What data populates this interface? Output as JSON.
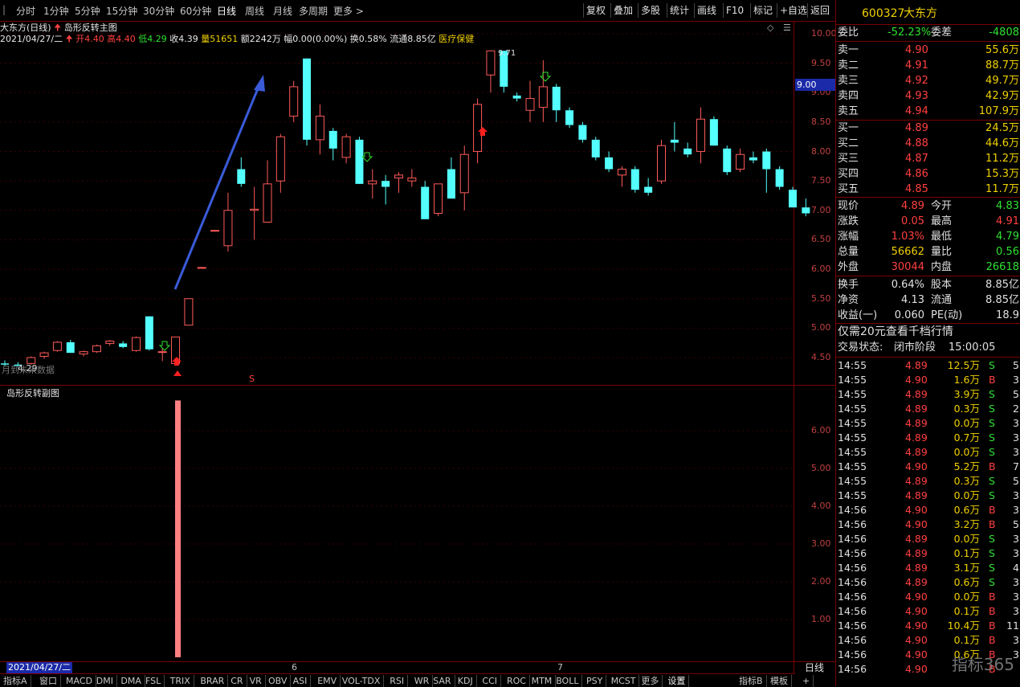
{
  "toolbar": {
    "periods": [
      "分时",
      "1分钟",
      "5分钟",
      "15分钟",
      "30分钟",
      "60分钟",
      "日线",
      "周线",
      "月线",
      "多周期",
      "更多 >"
    ],
    "active_period": "日线",
    "buttons": [
      "复权",
      "叠加",
      "多股",
      "统计",
      "画线",
      "F10",
      "标记",
      "+自选",
      "返回"
    ]
  },
  "chart": {
    "title": "大东方(日线)",
    "indicator_main": "岛形反转主图",
    "date": "2021/04/27/二",
    "open_label": "开",
    "open": "4.40",
    "high_label": "高",
    "high": "4.40",
    "low_label": "低",
    "low": "4.29",
    "close_label": "收",
    "close": "4.39",
    "vol_label": "量",
    "vol": "51651",
    "amount": "额2242万",
    "change": "幅0.00(0.00%)",
    "turnover": "换0.58%",
    "float": "流通8.85亿",
    "sector": "医疗保健",
    "peak_label": "9.71",
    "low_marker": "4.29",
    "no_data_text": "月到未来数据",
    "price_flag": "9.00",
    "s_marker": "S",
    "y_axis": [
      "10.00",
      "9.50",
      "9.00",
      "8.50",
      "8.00",
      "7.50",
      "7.00",
      "6.50",
      "6.00",
      "5.50",
      "5.00",
      "4.50"
    ],
    "indicator_sub": "岛形反转副图",
    "sub_axis": [
      "6.00",
      "5.00",
      "4.00",
      "3.00",
      "2.00",
      "1.00"
    ],
    "signal_value": 6.8,
    "x_dates": [
      "2021/04/27/二",
      "6",
      "7"
    ],
    "period_button": "日线",
    "candles": [
      {
        "o": 4.4,
        "h": 4.45,
        "l": 4.36,
        "c": 4.38
      },
      {
        "o": 4.38,
        "h": 4.42,
        "l": 4.33,
        "c": 4.36
      },
      {
        "o": 4.4,
        "h": 4.52,
        "l": 4.38,
        "c": 4.5
      },
      {
        "o": 4.52,
        "h": 4.6,
        "l": 4.48,
        "c": 4.58
      },
      {
        "o": 4.62,
        "h": 4.78,
        "l": 4.6,
        "c": 4.76
      },
      {
        "o": 4.76,
        "h": 4.8,
        "l": 4.58,
        "c": 4.58
      },
      {
        "o": 4.56,
        "h": 4.62,
        "l": 4.52,
        "c": 4.6
      },
      {
        "o": 4.6,
        "h": 4.72,
        "l": 4.58,
        "c": 4.7
      },
      {
        "o": 4.74,
        "h": 4.8,
        "l": 4.7,
        "c": 4.78
      },
      {
        "o": 4.74,
        "h": 4.78,
        "l": 4.66,
        "c": 4.68
      },
      {
        "o": 4.62,
        "h": 4.86,
        "l": 4.6,
        "c": 4.84
      },
      {
        "o": 5.2,
        "h": 5.2,
        "l": 4.62,
        "c": 4.64
      },
      {
        "o": 4.6,
        "h": 4.66,
        "l": 4.44,
        "c": 4.6
      },
      {
        "o": 4.4,
        "h": 4.85,
        "l": 4.4,
        "c": 4.85
      },
      {
        "o": 5.05,
        "h": 5.5,
        "l": 5.05,
        "c": 5.5
      },
      {
        "o": 6.02,
        "h": 6.04,
        "l": 6.02,
        "c": 6.03
      },
      {
        "o": 6.65,
        "h": 6.67,
        "l": 6.64,
        "c": 6.66
      },
      {
        "o": 6.4,
        "h": 7.3,
        "l": 6.3,
        "c": 7.0
      },
      {
        "o": 7.7,
        "h": 7.9,
        "l": 7.4,
        "c": 7.45
      },
      {
        "o": 7.0,
        "h": 7.4,
        "l": 6.5,
        "c": 7.02
      },
      {
        "o": 6.8,
        "h": 7.85,
        "l": 6.8,
        "c": 7.45
      },
      {
        "o": 7.5,
        "h": 8.3,
        "l": 7.3,
        "c": 8.25
      },
      {
        "o": 8.6,
        "h": 9.2,
        "l": 8.5,
        "c": 9.1
      },
      {
        "o": 9.58,
        "h": 9.58,
        "l": 8.1,
        "c": 8.2
      },
      {
        "o": 8.2,
        "h": 8.8,
        "l": 7.95,
        "c": 8.6
      },
      {
        "o": 8.35,
        "h": 8.4,
        "l": 7.85,
        "c": 8.05
      },
      {
        "o": 7.9,
        "h": 8.3,
        "l": 7.8,
        "c": 8.25
      },
      {
        "o": 8.2,
        "h": 8.25,
        "l": 7.45,
        "c": 7.45
      },
      {
        "o": 7.45,
        "h": 7.7,
        "l": 7.2,
        "c": 7.5
      },
      {
        "o": 7.5,
        "h": 7.6,
        "l": 7.1,
        "c": 7.4
      },
      {
        "o": 7.55,
        "h": 7.65,
        "l": 7.3,
        "c": 7.6
      },
      {
        "o": 7.5,
        "h": 7.7,
        "l": 7.4,
        "c": 7.55
      },
      {
        "o": 7.4,
        "h": 7.5,
        "l": 6.85,
        "c": 6.85
      },
      {
        "o": 6.95,
        "h": 7.45,
        "l": 6.9,
        "c": 7.45
      },
      {
        "o": 7.7,
        "h": 7.9,
        "l": 7.3,
        "c": 7.2
      },
      {
        "o": 7.3,
        "h": 8.1,
        "l": 7.0,
        "c": 7.95
      },
      {
        "o": 8.0,
        "h": 8.9,
        "l": 7.8,
        "c": 8.8
      },
      {
        "o": 9.3,
        "h": 9.72,
        "l": 9.0,
        "c": 9.71
      },
      {
        "o": 9.71,
        "h": 9.71,
        "l": 9.0,
        "c": 9.1
      },
      {
        "o": 8.95,
        "h": 9.0,
        "l": 8.85,
        "c": 8.9
      },
      {
        "o": 8.7,
        "h": 9.2,
        "l": 8.5,
        "c": 8.9
      },
      {
        "o": 8.75,
        "h": 9.55,
        "l": 8.5,
        "c": 9.1
      },
      {
        "o": 9.1,
        "h": 9.15,
        "l": 8.5,
        "c": 8.7
      },
      {
        "o": 8.7,
        "h": 8.75,
        "l": 8.4,
        "c": 8.45
      },
      {
        "o": 8.45,
        "h": 8.5,
        "l": 8.15,
        "c": 8.2
      },
      {
        "o": 8.2,
        "h": 8.25,
        "l": 7.85,
        "c": 7.9
      },
      {
        "o": 7.9,
        "h": 8.0,
        "l": 7.65,
        "c": 7.7
      },
      {
        "o": 7.6,
        "h": 7.75,
        "l": 7.4,
        "c": 7.7
      },
      {
        "o": 7.7,
        "h": 7.75,
        "l": 7.3,
        "c": 7.35
      },
      {
        "o": 7.4,
        "h": 7.55,
        "l": 7.25,
        "c": 7.3
      },
      {
        "o": 7.5,
        "h": 8.2,
        "l": 7.45,
        "c": 8.1
      },
      {
        "o": 8.2,
        "h": 8.5,
        "l": 8.0,
        "c": 8.15
      },
      {
        "o": 8.05,
        "h": 8.15,
        "l": 7.9,
        "c": 7.95
      },
      {
        "o": 8.0,
        "h": 8.75,
        "l": 7.8,
        "c": 8.55
      },
      {
        "o": 8.55,
        "h": 8.6,
        "l": 8.1,
        "c": 8.1
      },
      {
        "o": 8.05,
        "h": 8.1,
        "l": 7.6,
        "c": 7.65
      },
      {
        "o": 7.7,
        "h": 8.05,
        "l": 7.65,
        "c": 7.95
      },
      {
        "o": 7.9,
        "h": 8.0,
        "l": 7.8,
        "c": 7.85
      },
      {
        "o": 8.0,
        "h": 8.05,
        "l": 7.3,
        "c": 7.7
      },
      {
        "o": 7.7,
        "h": 7.75,
        "l": 7.35,
        "c": 7.4
      },
      {
        "o": 7.35,
        "h": 7.4,
        "l": 7.05,
        "c": 7.05
      },
      {
        "o": 7.05,
        "h": 7.2,
        "l": 6.9,
        "c": 6.95
      }
    ]
  },
  "tabs": [
    "指标A",
    "窗口",
    "MACD",
    "DMI",
    "DMA",
    "FSL",
    "TRIX",
    "BRAR",
    "CR",
    "VR",
    "OBV",
    "ASI",
    "EMV",
    "VOL-TDX",
    "RSI",
    "WR",
    "SAR",
    "KDJ",
    "CCI",
    "ROC",
    "MTM",
    "BOLL",
    "PSY",
    "MCST",
    "更多",
    "设置"
  ],
  "tabs_right": [
    "指标B",
    "模板",
    "+"
  ],
  "panel": {
    "code": "600327",
    "name": "大东方",
    "wei_label": "委比",
    "wei_value": "-52.23%",
    "weicha_label": "委差",
    "weicha_value": "-4808",
    "sells": [
      {
        "label": "卖五",
        "price": "4.94",
        "vol": "107.9万"
      },
      {
        "label": "卖四",
        "price": "4.93",
        "vol": "42.9万"
      },
      {
        "label": "卖三",
        "price": "4.92",
        "vol": "49.7万"
      },
      {
        "label": "卖二",
        "price": "4.91",
        "vol": "88.7万"
      },
      {
        "label": "卖一",
        "price": "4.90",
        "vol": "55.6万"
      }
    ],
    "buys": [
      {
        "label": "买一",
        "price": "4.89",
        "vol": "24.5万"
      },
      {
        "label": "买二",
        "price": "4.88",
        "vol": "44.6万"
      },
      {
        "label": "买三",
        "price": "4.87",
        "vol": "11.2万"
      },
      {
        "label": "买四",
        "price": "4.86",
        "vol": "15.3万"
      },
      {
        "label": "买五",
        "price": "4.85",
        "vol": "11.7万"
      }
    ],
    "quote": [
      {
        "l1": "现价",
        "v1": "4.89",
        "l2": "今开",
        "v2": "4.83"
      },
      {
        "l1": "涨跌",
        "v1": "0.05",
        "l2": "最高",
        "v2": "4.91"
      },
      {
        "l1": "涨幅",
        "v1": "1.03%",
        "l2": "最低",
        "v2": "4.79"
      },
      {
        "l1": "总量",
        "v1": "56662",
        "l2": "量比",
        "v2": "0.56"
      },
      {
        "l1": "外盘",
        "v1": "30044",
        "l2": "内盘",
        "v2": "26618"
      }
    ],
    "fund": [
      {
        "l1": "换手",
        "v1": "0.64%",
        "l2": "股本",
        "v2": "8.85亿"
      },
      {
        "l1": "净资",
        "v1": "4.13",
        "l2": "流通",
        "v2": "8.85亿"
      },
      {
        "l1": "收益(一)",
        "v1": "0.060",
        "l2": "PE(动)",
        "v2": "18.9"
      }
    ],
    "promo": "仅需20元查看千档行情",
    "status_label": "交易状态:",
    "status": "闭市阶段",
    "status_time": "15:00:05",
    "trades": [
      {
        "t": "14:55",
        "p": "4.89",
        "v": "12.5万",
        "s": "S",
        "n": "5"
      },
      {
        "t": "14:55",
        "p": "4.90",
        "v": "1.6万",
        "s": "B",
        "n": "3"
      },
      {
        "t": "14:55",
        "p": "4.89",
        "v": "3.9万",
        "s": "S",
        "n": "5"
      },
      {
        "t": "14:55",
        "p": "4.89",
        "v": "0.3万",
        "s": "S",
        "n": "2"
      },
      {
        "t": "14:55",
        "p": "4.89",
        "v": "0.0万",
        "s": "S",
        "n": "3"
      },
      {
        "t": "14:55",
        "p": "4.89",
        "v": "0.7万",
        "s": "S",
        "n": "3"
      },
      {
        "t": "14:55",
        "p": "4.89",
        "v": "0.0万",
        "s": "S",
        "n": "3"
      },
      {
        "t": "14:55",
        "p": "4.90",
        "v": "5.2万",
        "s": "B",
        "n": "7"
      },
      {
        "t": "14:55",
        "p": "4.89",
        "v": "0.3万",
        "s": "S",
        "n": "5"
      },
      {
        "t": "14:55",
        "p": "4.89",
        "v": "0.0万",
        "s": "S",
        "n": "3"
      },
      {
        "t": "14:56",
        "p": "4.90",
        "v": "0.6万",
        "s": "B",
        "n": "3"
      },
      {
        "t": "14:56",
        "p": "4.90",
        "v": "3.2万",
        "s": "B",
        "n": "5"
      },
      {
        "t": "14:56",
        "p": "4.89",
        "v": "0.0万",
        "s": "S",
        "n": "3"
      },
      {
        "t": "14:56",
        "p": "4.89",
        "v": "0.1万",
        "s": "S",
        "n": "3"
      },
      {
        "t": "14:56",
        "p": "4.89",
        "v": "3.1万",
        "s": "S",
        "n": "4"
      },
      {
        "t": "14:56",
        "p": "4.89",
        "v": "0.6万",
        "s": "S",
        "n": "3"
      },
      {
        "t": "14:56",
        "p": "4.90",
        "v": "0.0万",
        "s": "B",
        "n": "3"
      },
      {
        "t": "14:56",
        "p": "4.90",
        "v": "0.1万",
        "s": "B",
        "n": "3"
      },
      {
        "t": "14:56",
        "p": "4.90",
        "v": "10.4万",
        "s": "B",
        "n": "11"
      },
      {
        "t": "14:56",
        "p": "4.90",
        "v": "0.1万",
        "s": "B",
        "n": "3"
      },
      {
        "t": "14:56",
        "p": "4.90",
        "v": "0.6万",
        "s": "B",
        "n": "3"
      },
      {
        "t": "14:56",
        "p": "4.90",
        "v": "",
        "s": "B",
        "n": ""
      }
    ],
    "watermark": "指标365"
  }
}
